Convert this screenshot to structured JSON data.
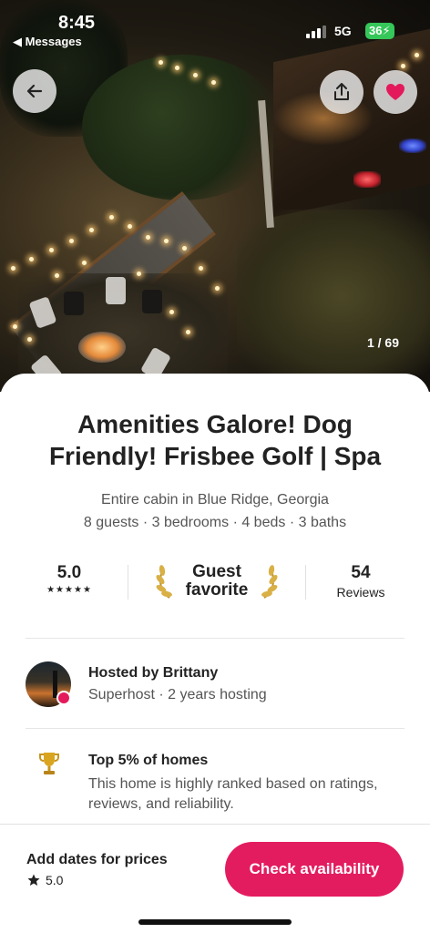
{
  "status_bar": {
    "time": "8:45",
    "back_app": "◀ Messages",
    "network": "5G",
    "battery": "36"
  },
  "photo": {
    "counter": "1 / 69"
  },
  "icons": {
    "back": "arrow-left-icon",
    "share": "share-icon",
    "favorite": "heart-icon",
    "trophy": "trophy-icon",
    "star": "star-icon"
  },
  "colors": {
    "brand": "#e31c5f",
    "heart": "#e3195c",
    "text": "#222222",
    "muted": "#555555"
  },
  "listing": {
    "title": "Amenities Galore! Dog Friendly! Frisbee Golf | Spa",
    "subtitle": "Entire cabin in Blue Ridge, Georgia",
    "details": "8 guests · 3 bedrooms · 4 beds · 3 baths"
  },
  "stats": {
    "rating": "5.0",
    "stars": "★★★★★",
    "guest_favorite": "Guest favorite",
    "reviews_count": "54",
    "reviews_label": "Reviews"
  },
  "host": {
    "name": "Hosted by Brittany",
    "meta": "Superhost · 2 years hosting"
  },
  "highlight": {
    "title": "Top 5% of homes",
    "description": "This home is highly ranked based on ratings, reviews, and reliability."
  },
  "footer": {
    "title": "Add dates for prices",
    "rating": "5.0",
    "cta": "Check availability"
  }
}
